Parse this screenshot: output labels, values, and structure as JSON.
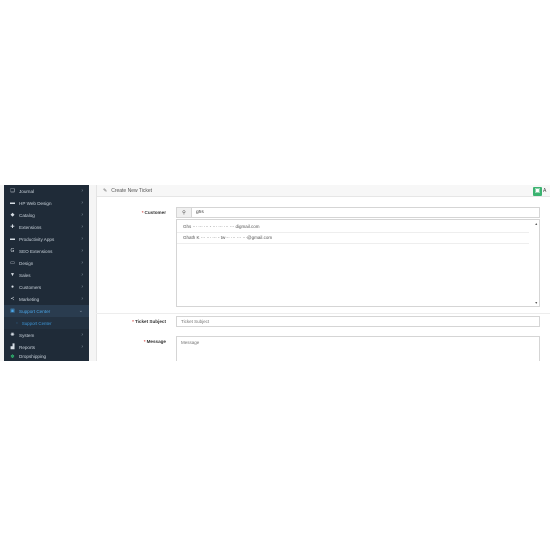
{
  "sidebar": {
    "items": [
      {
        "icon": "journal-icon",
        "glyph": "❑",
        "label": "Journal",
        "active": false
      },
      {
        "icon": "web-design-icon",
        "glyph": "▬",
        "label": "HP Web Design",
        "active": false
      },
      {
        "icon": "tag-icon",
        "glyph": "◆",
        "label": "Catalog",
        "active": false
      },
      {
        "icon": "puzzle-icon",
        "glyph": "✚",
        "label": "Extensions",
        "active": false
      },
      {
        "icon": "apps-icon",
        "glyph": "▬",
        "label": "Productivity Apps",
        "active": false
      },
      {
        "icon": "seo-icon",
        "glyph": "G",
        "label": "SEO Extensions",
        "active": false
      },
      {
        "icon": "monitor-icon",
        "glyph": "▭",
        "label": "Design",
        "active": false
      },
      {
        "icon": "cart-icon",
        "glyph": "▼",
        "label": "Sales",
        "active": false
      },
      {
        "icon": "user-icon",
        "glyph": "●",
        "label": "Customers",
        "active": false
      },
      {
        "icon": "share-icon",
        "glyph": "≺",
        "label": "Marketing",
        "active": false
      },
      {
        "icon": "support-icon",
        "glyph": "▣",
        "label": "Support Center",
        "active": true
      }
    ],
    "subitem": {
      "label": "Support Center"
    },
    "items_after": [
      {
        "icon": "cog-icon",
        "glyph": "✺",
        "label": "System"
      },
      {
        "icon": "bar-chart-icon",
        "glyph": "▟",
        "label": "Reports"
      }
    ],
    "cut_item": {
      "icon": "leaf-icon",
      "glyph": "✽",
      "label": "Dropshipping"
    }
  },
  "panel": {
    "title": "Create New Ticket",
    "save_glyph": "▣",
    "edge_text": "A"
  },
  "form": {
    "customer_label": "Customer",
    "customer_value": "ghs",
    "search_glyph": "⚲",
    "results": [
      "Ghs  ⋯ ⋯ ⋯ - ⋯ ⋯ ⋯  ⋯ digmail.com",
      "Ghath K ⋯ ⋯ ⋯ - tw⋯ ⋯ ⋯ ⋯@gmail.com"
    ],
    "subject_label": "Ticket Subject",
    "subject_placeholder": "Ticket Subject",
    "message_label": "Message",
    "message_placeholder": "Message"
  }
}
